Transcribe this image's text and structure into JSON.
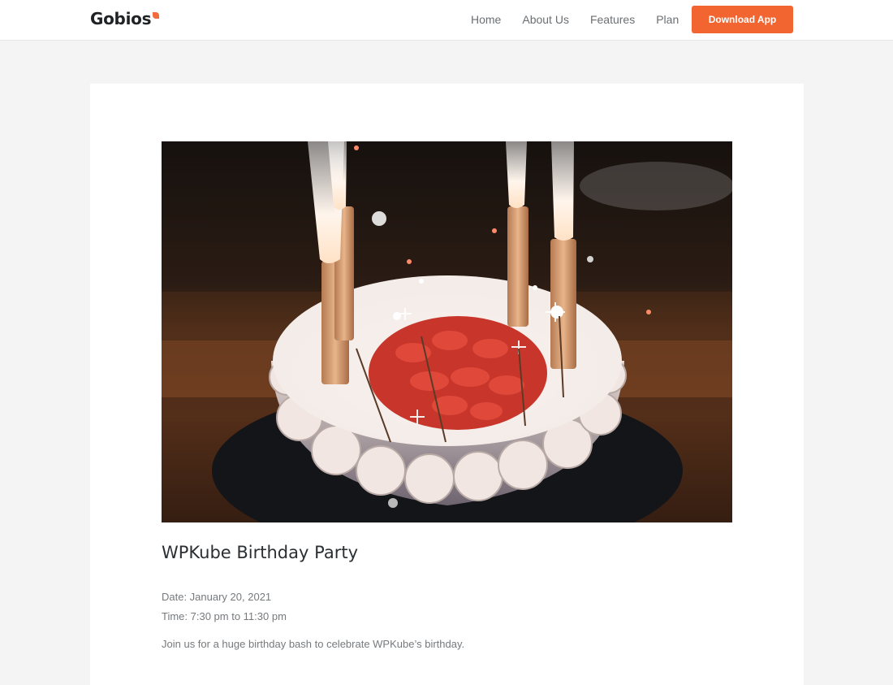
{
  "header": {
    "logo_text": "Gobios",
    "nav": [
      "Home",
      "About Us",
      "Features",
      "Plan"
    ],
    "cta_label": "Download App"
  },
  "event": {
    "title": "WPKube Birthday Party",
    "date": "Date: January 20, 2021",
    "time": "Time: 7:30 pm to 11:30 pm",
    "description": "Join us for a huge birthday bash to celebrate WPKube’s birthday."
  },
  "colors": {
    "accent": "#f26531",
    "page_bg": "#f4f4f4",
    "heading": "#2a2f33",
    "body_text": "#767a7d"
  },
  "icons": {
    "logo_mark": "logo-mark-icon"
  }
}
